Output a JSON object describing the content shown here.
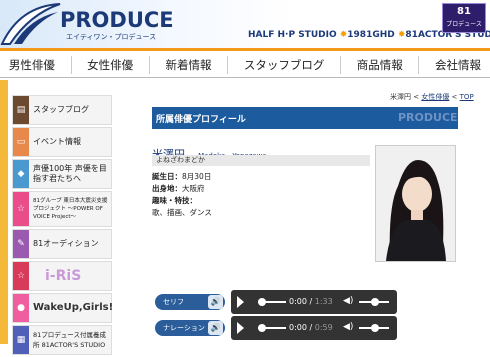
{
  "header": {
    "logo_text": "PRODUCE",
    "logo_sub": "エイティワン・プロデュース",
    "studios": [
      "HALF H·P STUDIO",
      "1981GHD",
      "81ACTOR'S STUDIO"
    ],
    "badge_top": "81",
    "badge_bottom": "プロデュース"
  },
  "nav": {
    "items": [
      "男性俳優",
      "女性俳優",
      "新着情報",
      "スタッフブログ",
      "商品情報",
      "会社情報"
    ]
  },
  "sidebar": {
    "items": [
      {
        "label": "スタッフブログ",
        "icon": "book-icon",
        "color": "#6b4a2f"
      },
      {
        "label": "イベント情報",
        "icon": "ticket-icon",
        "color": "#e8884a"
      },
      {
        "label": "声優100年 声優を目指す君たちへ",
        "icon": "mic-icon",
        "color": "#4a9ad0"
      },
      {
        "label": "81グループ 東日本大震災支援プロジェクト ～POWER OF VOICE Project～",
        "icon": "star-icon",
        "color": "#ea4e8a"
      },
      {
        "label": "81オーディション",
        "icon": "audition-icon",
        "color": "#9a5ab0"
      },
      {
        "label": "i-RiS",
        "icon": "star-icon",
        "color": "#d83a5a"
      },
      {
        "label": "WakeUp,Girls!",
        "icon": "dot-icon",
        "color": "#ef5fa0"
      },
      {
        "label": "81プロデュース付属養成所 81ACTOR'S STUDIO",
        "icon": "studio-icon",
        "color": "#5060b8"
      }
    ]
  },
  "breadcrumb": {
    "current": "米澤円",
    "parent": "女性俳優",
    "top": "TOP",
    "sep": " < "
  },
  "profile": {
    "section_title": "所属俳優プロフィール",
    "section_watermark": "PRODUCE",
    "name_jp": "米澤円",
    "name_en": "Madoka　Yonezawa",
    "name_kana": "よねざわまどか",
    "birthday_label": "誕生日：",
    "birthday": "8月30日",
    "birthplace_label": "出身地：",
    "birthplace": "大阪府",
    "hobby_label": "趣味・特技：",
    "hobby": "歌、描画、ダンス"
  },
  "audio": [
    {
      "label": "セリフ",
      "current": "0:00",
      "total": "1:33"
    },
    {
      "label": "ナレーション",
      "current": "0:00",
      "total": "0:59"
    }
  ],
  "colors": {
    "brand": "#1c3a78",
    "accent": "#f39a1b",
    "profile_bar": "#1c5b9e"
  }
}
